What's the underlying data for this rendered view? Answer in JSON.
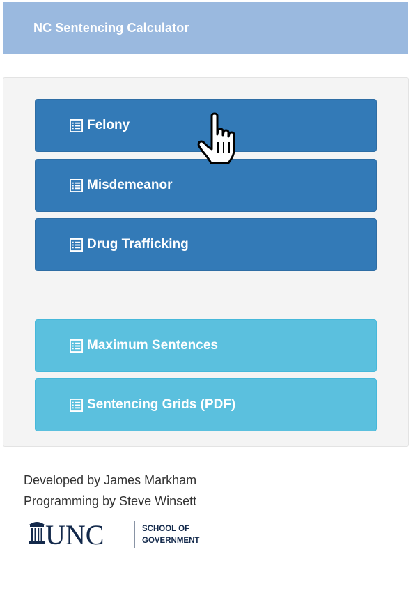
{
  "header": {
    "title": "NC Sentencing Calculator",
    "bg_color": "#9ab9df"
  },
  "buttons": {
    "felony": {
      "label": "Felony",
      "icon": "list-alt-icon"
    },
    "misdemeanor": {
      "label": "Misdemeanor",
      "icon": "list-alt-icon"
    },
    "drug_trafficking": {
      "label": "Drug Trafficking",
      "icon": "list-alt-icon"
    },
    "maximum_sentences": {
      "label": "Maximum Sentences",
      "icon": "list-alt-icon"
    },
    "sentencing_grids": {
      "label": "Sentencing Grids (PDF)",
      "icon": "list-alt-icon"
    }
  },
  "colors": {
    "primary": "#337ab7",
    "info": "#5bc0de",
    "panel_bg": "#f4f4f4"
  },
  "footer": {
    "developed_by": "Developed by James Markham",
    "programming_by": "Programming by Steve Winsett"
  },
  "logo": {
    "main_text": "UNC",
    "sub_line1": "SCHOOL OF",
    "sub_line2": "GOVERNMENT",
    "color": "#13294b"
  },
  "cursor": {
    "type": "hand-pointer-icon"
  }
}
